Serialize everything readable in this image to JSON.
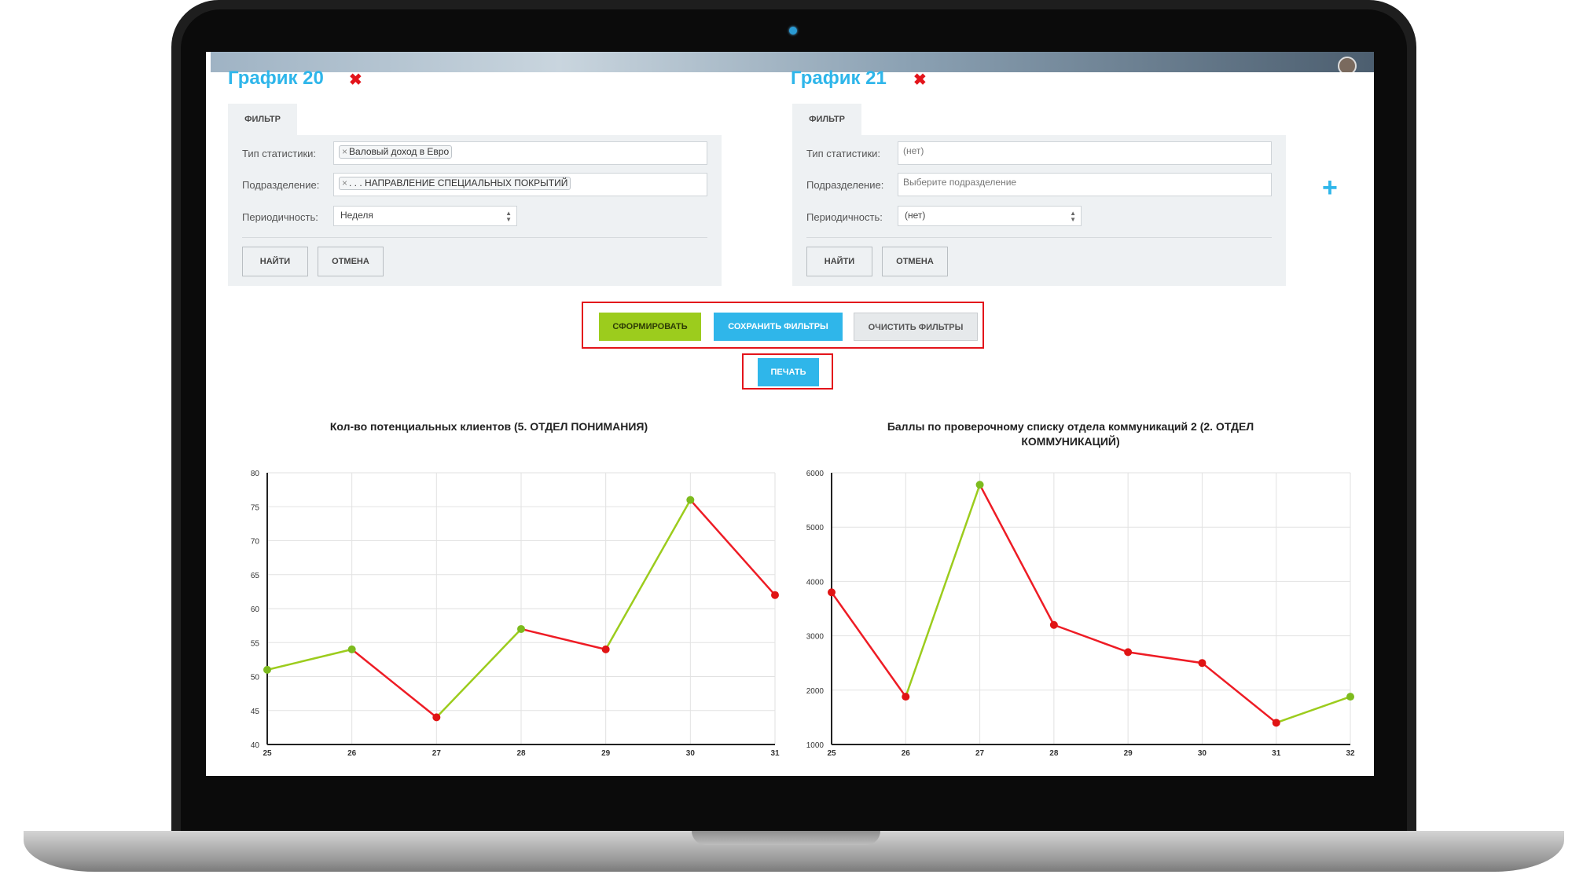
{
  "panels": [
    {
      "title": "График 20",
      "filter_tab": "ФИЛЬТР",
      "type_label": "Тип статистики:",
      "type_value": "Валовый доход в Евро",
      "division_label": "Подразделение:",
      "division_value": ". . . НАПРАВЛЕНИЕ СПЕЦИАЛЬНЫХ ПОКРЫТИЙ",
      "period_label": "Периодичность:",
      "period_value": "Неделя",
      "find_label": "НАЙТИ",
      "cancel_label": "ОТМЕНА"
    },
    {
      "title": "График 21",
      "filter_tab": "ФИЛЬТР",
      "type_label": "Тип статистики:",
      "type_placeholder": "(нет)",
      "division_label": "Подразделение:",
      "division_placeholder": "Выберите подразделение",
      "period_label": "Периодичность:",
      "period_value": "(нет)",
      "find_label": "НАЙТИ",
      "cancel_label": "ОТМЕНА"
    }
  ],
  "actions": {
    "generate_label": "СФОРМИРОВАТЬ",
    "save_filters_label": "СОХРАНИТЬ ФИЛЬТРЫ",
    "clear_filters_label": "ОЧИСТИТЬ ФИЛЬТРЫ",
    "print_label": "ПЕЧАТЬ"
  },
  "icons": {
    "close": "close-icon",
    "add": "plus-icon",
    "chip_remove": "×"
  },
  "colors": {
    "accent": "#2fb6ea",
    "danger": "#e3141b",
    "up": "#9ccc1d",
    "down": "#ee1c25",
    "point_up": "#7dbb1e",
    "point_down": "#e01414"
  },
  "chart_data": [
    {
      "type": "line",
      "title": "Кол-во потенциальных клиентов (5. ОТДЕЛ ПОНИМАНИЯ)",
      "x": [
        25,
        26,
        27,
        28,
        29,
        30,
        31
      ],
      "y": [
        51,
        54,
        44,
        57,
        54,
        76,
        62
      ],
      "ylim": [
        40,
        80
      ],
      "yticks": [
        40,
        45,
        50,
        55,
        60,
        65,
        70,
        75,
        80
      ],
      "grid": true,
      "segment_coloring": "green when rising, red when falling"
    },
    {
      "type": "line",
      "title": "Баллы по проверочному списку отдела коммуникаций 2 (2. ОТДЕЛ КОММУНИКАЦИЙ)",
      "x": [
        25,
        26,
        27,
        28,
        29,
        30,
        31,
        32
      ],
      "y": [
        3800,
        1880,
        5780,
        3200,
        2700,
        2500,
        1400,
        1880
      ],
      "ylim": [
        1000,
        6000
      ],
      "yticks": [
        1000,
        2000,
        3000,
        4000,
        5000,
        6000
      ],
      "grid": true,
      "segment_coloring": "green when rising, red when falling"
    }
  ]
}
